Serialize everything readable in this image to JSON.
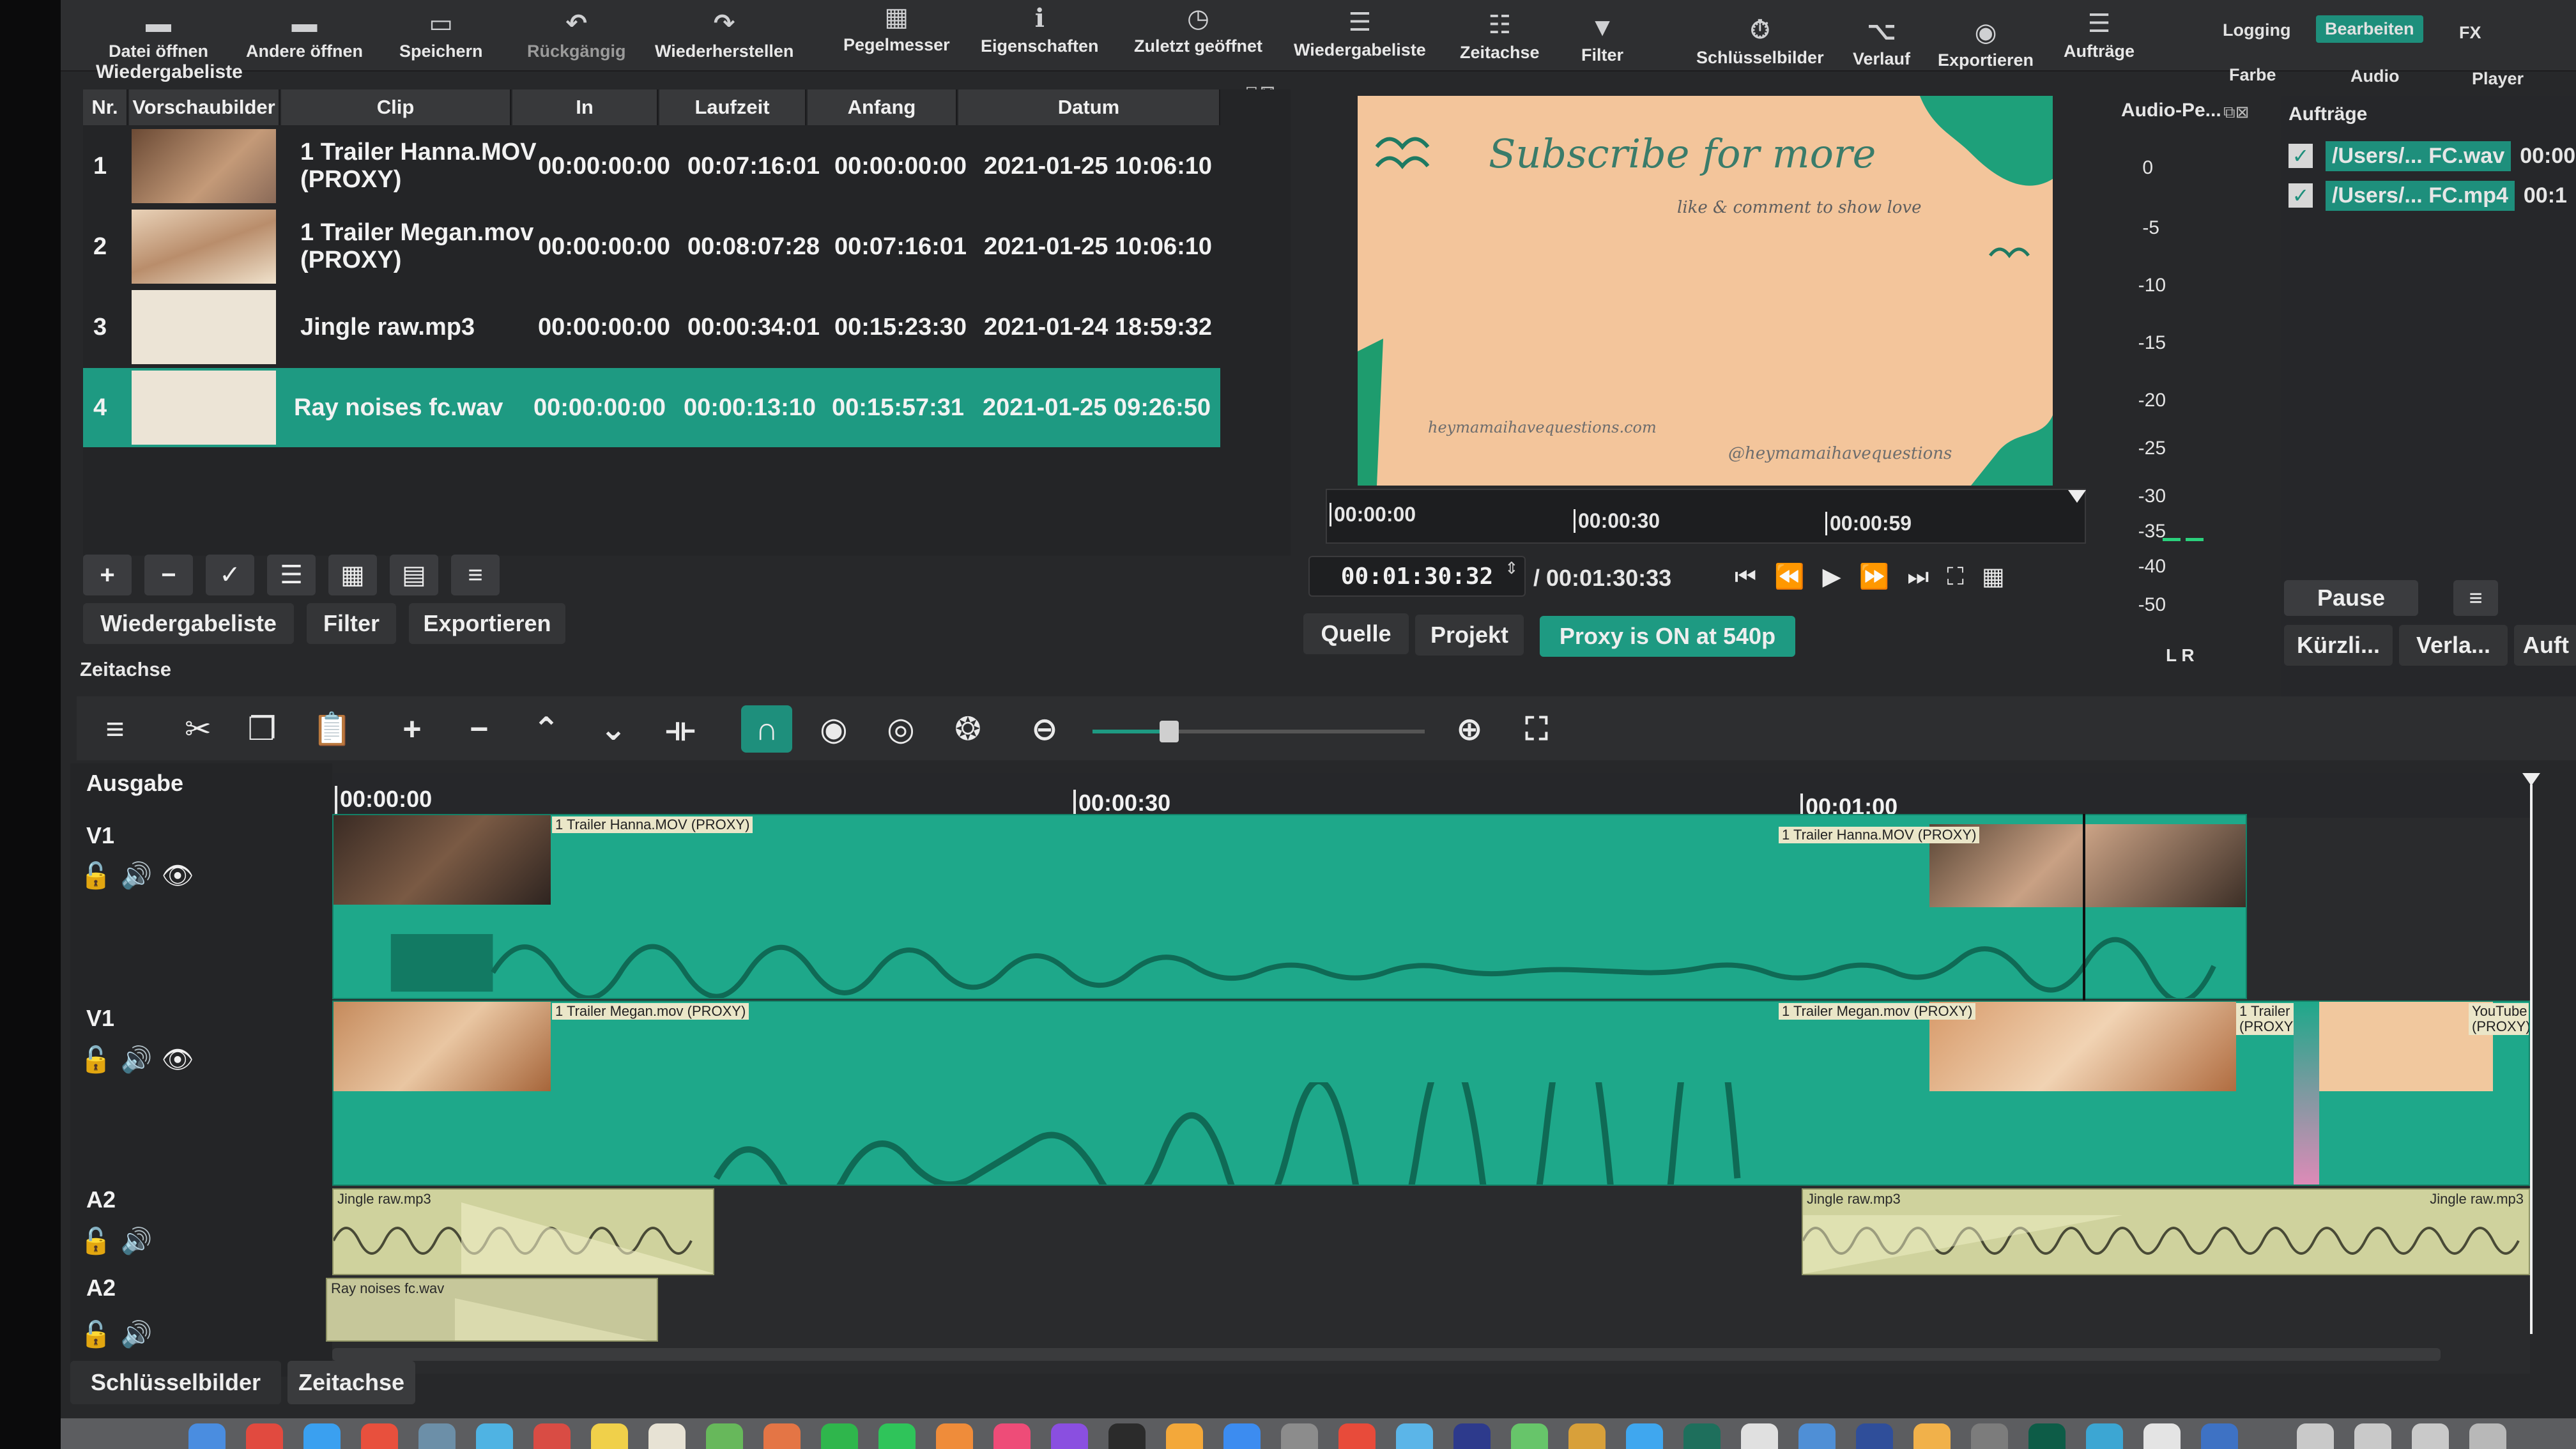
{
  "toolbar": {
    "buttons": [
      {
        "label": "Datei öffnen",
        "icon": "folder-open-icon"
      },
      {
        "label": "Andere öffnen",
        "icon": "folder-plus-icon"
      },
      {
        "label": "Speichern",
        "icon": "save-icon"
      },
      {
        "label": "Rückgängig",
        "icon": "undo-icon"
      },
      {
        "label": "Wiederherstellen",
        "icon": "redo-icon"
      },
      {
        "label": "Pegelmesser",
        "icon": "level-meter-icon"
      },
      {
        "label": "Eigenschaften",
        "icon": "info-icon"
      },
      {
        "label": "Zuletzt geöffnet",
        "icon": "clock-icon"
      },
      {
        "label": "Wiedergabeliste",
        "icon": "list-icon"
      },
      {
        "label": "Zeitachse",
        "icon": "timeline-icon"
      },
      {
        "label": "Filter",
        "icon": "filter-icon"
      },
      {
        "label": "Schlüsselbilder",
        "icon": "stopwatch-icon"
      },
      {
        "label": "Verlauf",
        "icon": "history-icon"
      },
      {
        "label": "Exportieren",
        "icon": "export-icon"
      },
      {
        "label": "Aufträge",
        "icon": "jobs-icon"
      }
    ],
    "layouts_top": [
      "Logging",
      "Bearbeiten",
      "FX"
    ],
    "layouts_bottom": [
      "Farbe",
      "Audio",
      "Player"
    ]
  },
  "playlist": {
    "title": "Wiedergabeliste",
    "columns": [
      "Nr.",
      "Vorschaubilder",
      "Clip",
      "In",
      "Laufzeit",
      "Anfang",
      "Datum"
    ],
    "rows": [
      {
        "nr": "1",
        "clip": "1 Trailer Hanna.MOV",
        "clip2": "(PROXY)",
        "in": "00:00:00:00",
        "duration": "00:07:16:01",
        "start": "00:00:00:00",
        "date": "2021-01-25 10:06:10"
      },
      {
        "nr": "2",
        "clip": "1 Trailer Megan.mov",
        "clip2": "(PROXY)",
        "in": "00:00:00:00",
        "duration": "00:08:07:28",
        "start": "00:07:16:01",
        "date": "2021-01-25 10:06:10"
      },
      {
        "nr": "3",
        "clip": "Jingle raw.mp3",
        "clip2": "",
        "in": "00:00:00:00",
        "duration": "00:00:34:01",
        "start": "00:15:23:30",
        "date": "2021-01-24 18:59:32"
      },
      {
        "nr": "4",
        "clip": "Ray noises fc.wav",
        "clip2": "",
        "in": "00:00:00:00",
        "duration": "00:00:13:10",
        "start": "00:15:57:31",
        "date": "2021-01-25 09:26:50"
      }
    ],
    "selected_row": 4,
    "tabs": [
      "Wiedergabeliste",
      "Filter",
      "Exportieren"
    ]
  },
  "preview": {
    "headline": "Subscribe for more",
    "subline": "like & comment to show love",
    "website": "heymamaihavequestions.com",
    "handle": "@heymamaihavequestions",
    "ruler_ticks": [
      "00:00:00",
      "00:00:30",
      "00:00:59"
    ],
    "timecode": "00:01:30:32",
    "duration": "/ 00:01:30:33",
    "tabs": [
      "Quelle",
      "Projekt"
    ],
    "proxy_status": "Proxy is ON at 540p"
  },
  "audio_meter": {
    "title": "Audio-Pe...",
    "scale": [
      "0",
      "-5",
      "-10",
      "-15",
      "-20",
      "-25",
      "-30",
      "-35",
      "-40",
      "-50"
    ],
    "channels": "L R"
  },
  "jobs": {
    "title": "Aufträge",
    "items": [
      {
        "name": "/Users/... FC.wav",
        "time": "00:00"
      },
      {
        "name": "/Users/... FC.mp4",
        "time": "00:1"
      }
    ],
    "pause_label": "Pause",
    "bottom_tabs": [
      "Kürzli...",
      "Verla...",
      "Auft"
    ]
  },
  "timeline": {
    "title": "Zeitachse",
    "output_label": "Ausgabe",
    "ruler_ticks": [
      "00:00:00",
      "00:00:30",
      "00:01:00"
    ],
    "tracks": [
      {
        "name": "V1",
        "clips": [
          "1 Trailer Hanna.MOV (PROXY)",
          "1 Trailer Hanna.MOV (PROXY)"
        ]
      },
      {
        "name": "V1",
        "clips": [
          "1 Trailer Megan.mov (PROXY)",
          "1 Trailer Megan.mov (PROXY)",
          "1 Trailer (PROXY)",
          "YouTube (PROXY)"
        ]
      },
      {
        "name": "A2",
        "clips": [
          "Jingle raw.mp3",
          "Jingle raw.mp3",
          "Jingle raw.mp3"
        ]
      },
      {
        "name": "A2",
        "clips": [
          "Ray noises fc.wav"
        ]
      }
    ],
    "bottom_tabs": [
      "Schlüsselbilder",
      "Zeitachse"
    ]
  }
}
